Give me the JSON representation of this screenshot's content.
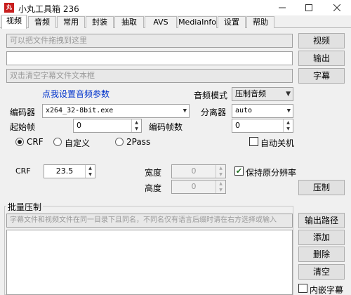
{
  "window": {
    "title": "小丸工具箱 236",
    "icon_text": "丸"
  },
  "tabs": [
    {
      "label": "视频"
    },
    {
      "label": "音频"
    },
    {
      "label": "常用"
    },
    {
      "label": "封装"
    },
    {
      "label": "抽取"
    },
    {
      "label": "AVS"
    },
    {
      "label": "MediaInfo"
    },
    {
      "label": "设置"
    },
    {
      "label": "帮助"
    }
  ],
  "files": {
    "video_placeholder": "可以把文件拖拽到这里",
    "output_value": "",
    "subtitle_placeholder": "双击清空字幕文件文本框",
    "video_button": "视频",
    "output_button": "输出",
    "subtitle_button": "字幕"
  },
  "audio": {
    "settings_link": "点我设置音频参数",
    "mode_label": "音频模式",
    "mode_value": "压制音频"
  },
  "encoder": {
    "label": "编码器",
    "value": "x264_32-8bit.exe",
    "splitter_label": "分离器",
    "splitter_value": "auto"
  },
  "frames": {
    "start_label": "起始帧",
    "start_value": "0",
    "count_label": "编码帧数",
    "count_value": "0"
  },
  "rate_mode": {
    "options": [
      {
        "label": "CRF"
      },
      {
        "label": "自定义"
      },
      {
        "label": "2Pass"
      }
    ],
    "selected": "CRF",
    "auto_shutdown_label": "自动关机"
  },
  "crf": {
    "label": "CRF",
    "value": "23.5",
    "width_label": "宽度",
    "width_value": "0",
    "height_label": "高度",
    "height_value": "0",
    "keep_res_label": "保持原分辨率",
    "encode_button": "压制"
  },
  "batch": {
    "title": "批量压制",
    "hint": "字幕文件和视频文件在同一目录下且同名，不同名仅有语言后缀时请在右方选择或输入",
    "output_path_button": "输出路径",
    "add_button": "添加",
    "delete_button": "删除",
    "clear_button": "清空",
    "embed_subtitle_label": "内嵌字幕"
  },
  "colors": {
    "link": "#0033cc",
    "check": "#1e6e1e"
  }
}
